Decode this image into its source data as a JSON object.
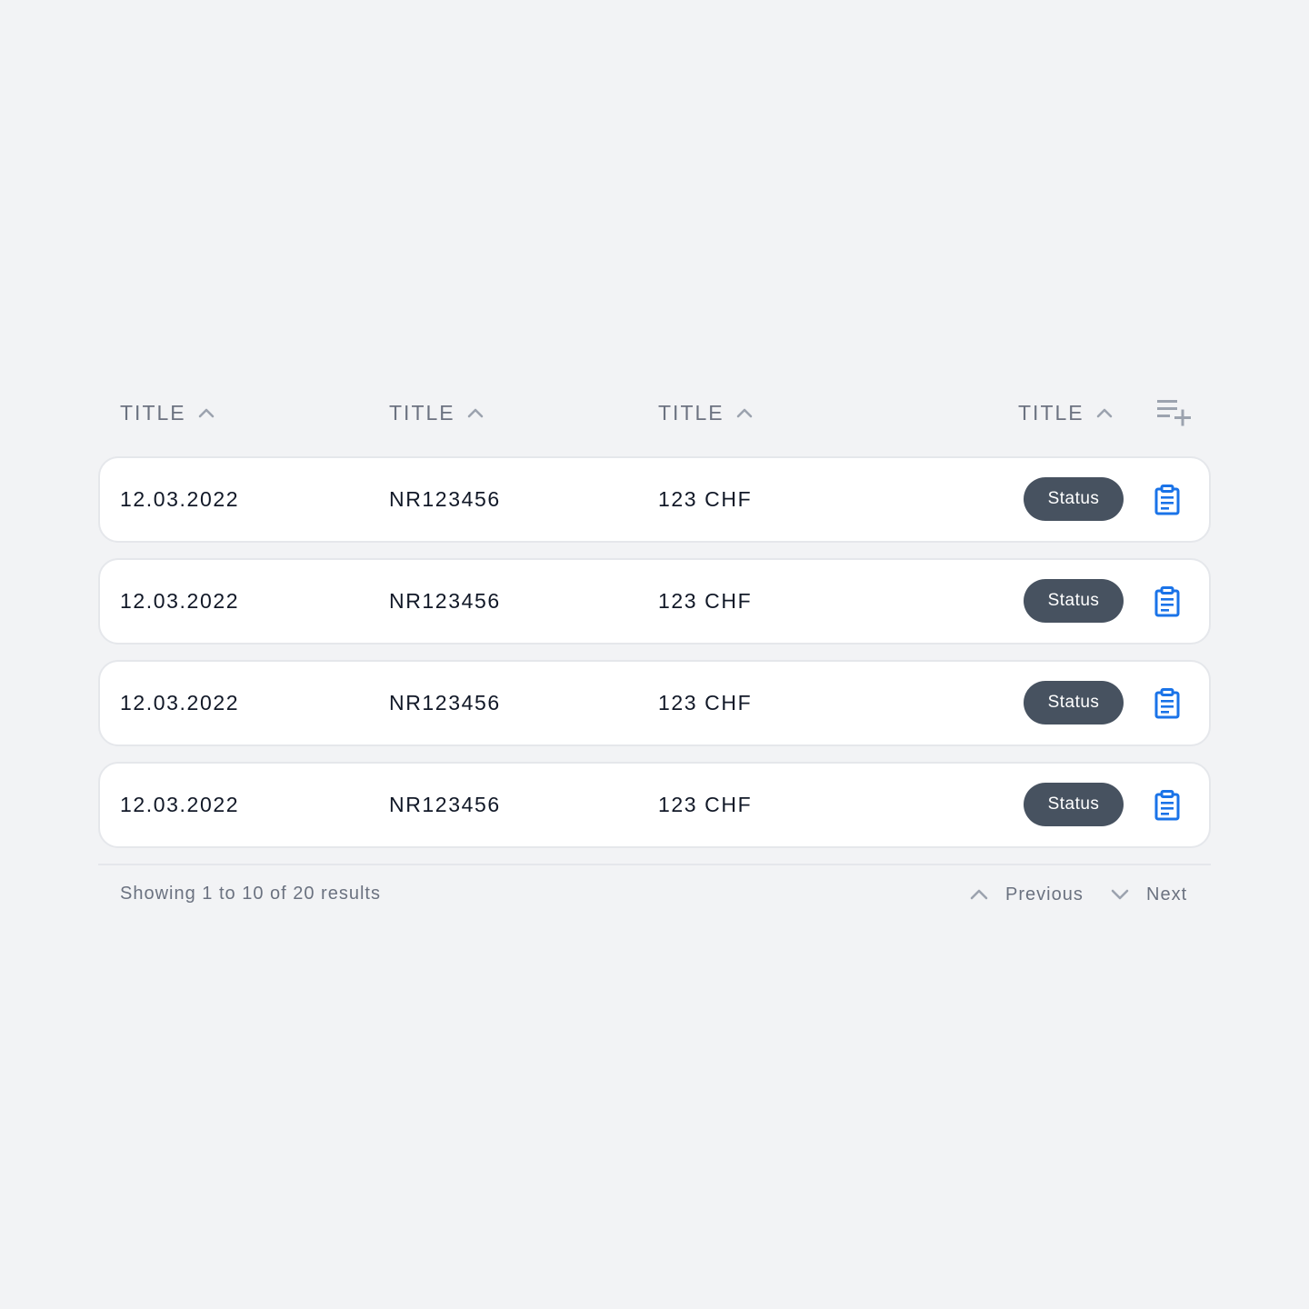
{
  "table": {
    "headers": [
      {
        "label": "TITLE",
        "sort_icon": "chevron-up-icon"
      },
      {
        "label": "TITLE",
        "sort_icon": "chevron-up-icon"
      },
      {
        "label": "TITLE",
        "sort_icon": "chevron-up-icon"
      },
      {
        "label": "TITLE",
        "sort_icon": "chevron-up-icon"
      }
    ],
    "add_column_icon": "playlist-add-icon",
    "rows": [
      {
        "date": "12.03.2022",
        "number": "NR123456",
        "amount": "123 CHF",
        "status": "Status",
        "action_icon": "clipboard-icon"
      },
      {
        "date": "12.03.2022",
        "number": "NR123456",
        "amount": "123 CHF",
        "status": "Status",
        "action_icon": "clipboard-icon"
      },
      {
        "date": "12.03.2022",
        "number": "NR123456",
        "amount": "123 CHF",
        "status": "Status",
        "action_icon": "clipboard-icon"
      },
      {
        "date": "12.03.2022",
        "number": "NR123456",
        "amount": "123 CHF",
        "status": "Status",
        "action_icon": "clipboard-icon"
      }
    ]
  },
  "pagination": {
    "summary": "Showing 1 to 10 of 20 results",
    "previous_label": "Previous",
    "next_label": "Next"
  },
  "colors": {
    "background": "#f2f3f5",
    "badge": "#475260",
    "accent_icon": "#1a73e8",
    "muted_text": "#6b7280"
  }
}
